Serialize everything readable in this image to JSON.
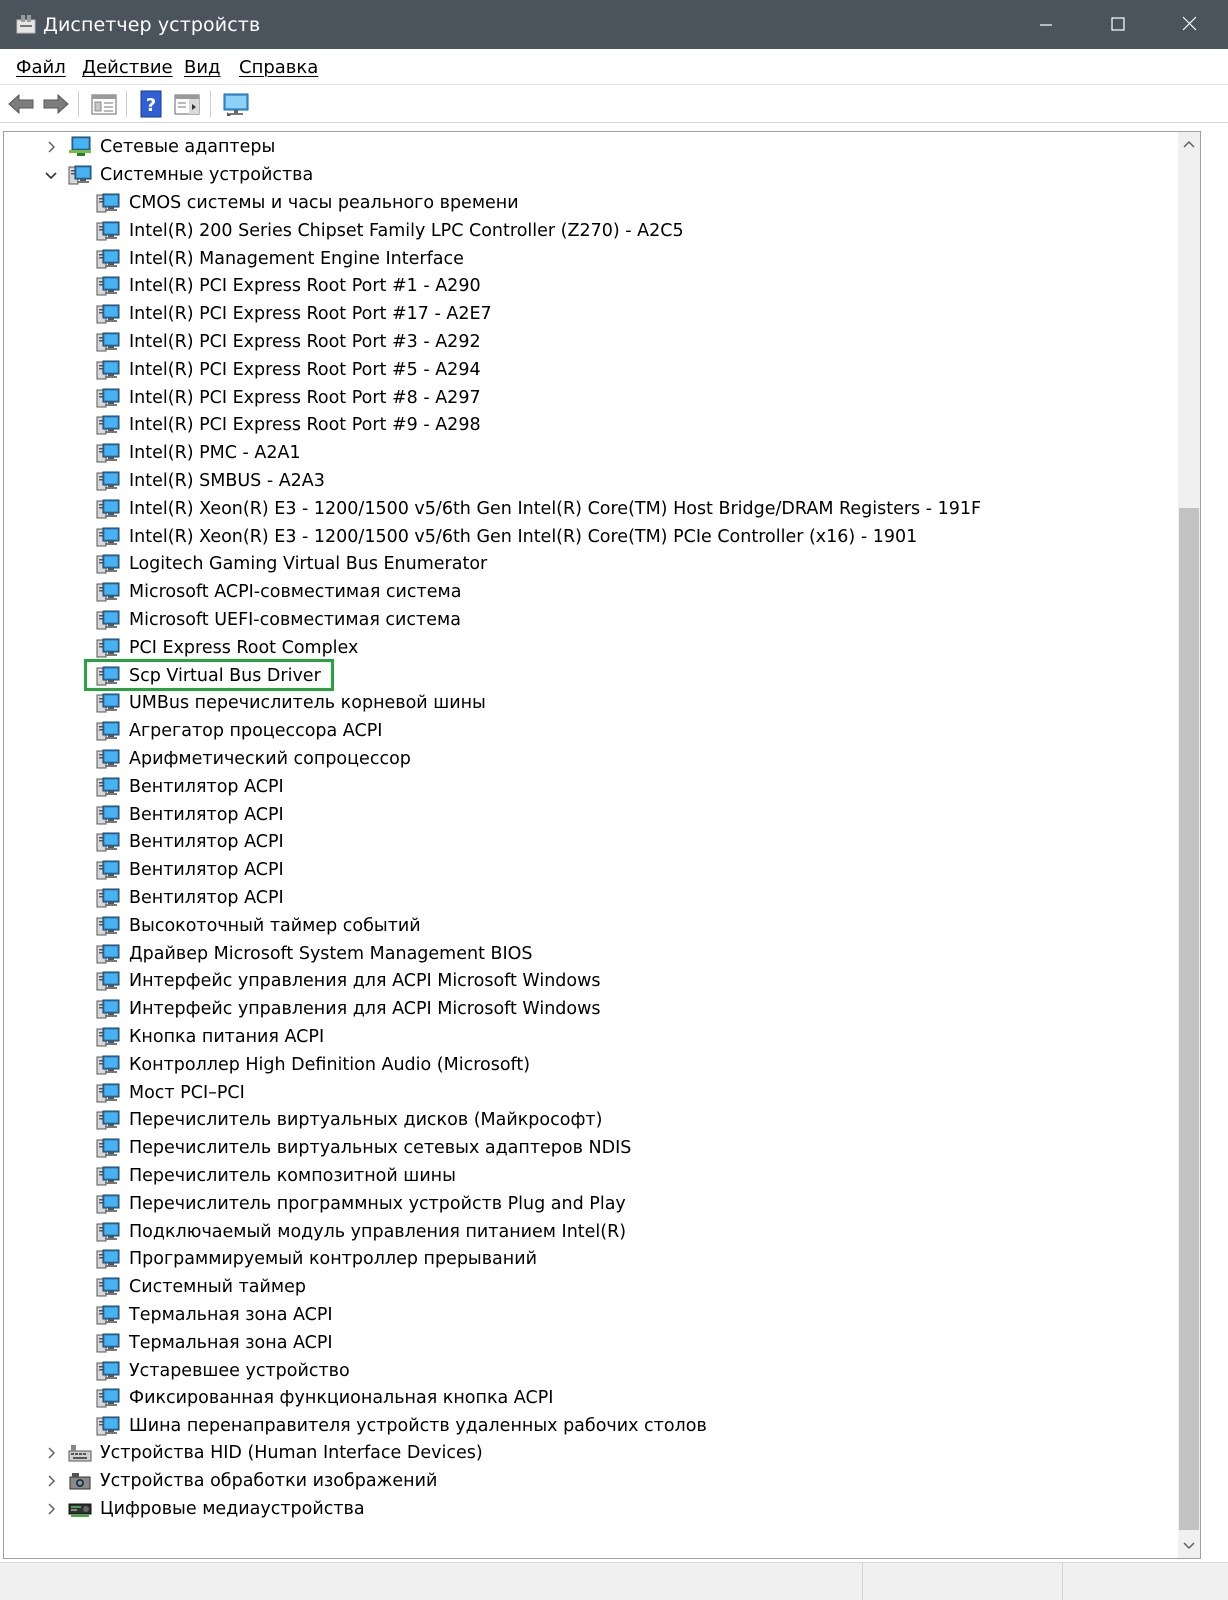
{
  "window": {
    "title": "Диспетчер устройств",
    "app_icon": "device-manager-icon",
    "controls": [
      "minimize-icon",
      "maximize-icon",
      "close-icon"
    ]
  },
  "menu": {
    "file": "Файл",
    "action": "Действие",
    "view": "Вид",
    "help": "Справка"
  },
  "toolbar": {
    "buttons": [
      "back-arrow-icon",
      "forward-arrow-icon",
      "properties-icon",
      "help-icon",
      "action-pane-icon",
      "monitor-scan-icon"
    ]
  },
  "tree": {
    "categories": {
      "network": "Сетевые адаптеры",
      "system": "Системные устройства",
      "hid": "Устройства HID (Human Interface Devices)",
      "imaging": "Устройства обработки изображений",
      "media": "Цифровые медиаустройства"
    },
    "system_devices": [
      "CMOS системы и часы реального времени",
      "Intel(R) 200 Series Chipset Family LPC Controller (Z270) - A2C5",
      "Intel(R) Management Engine Interface",
      "Intel(R) PCI Express Root Port #1 - A290",
      "Intel(R) PCI Express Root Port #17 - A2E7",
      "Intel(R) PCI Express Root Port #3 - A292",
      "Intel(R) PCI Express Root Port #5 - A294",
      "Intel(R) PCI Express Root Port #8 - A297",
      "Intel(R) PCI Express Root Port #9 - A298",
      "Intel(R) PMC - A2A1",
      "Intel(R) SMBUS - A2A3",
      "Intel(R) Xeon(R) E3 - 1200/1500 v5/6th Gen Intel(R) Core(TM) Host Bridge/DRAM Registers - 191F",
      "Intel(R) Xeon(R) E3 - 1200/1500 v5/6th Gen Intel(R) Core(TM) PCIe Controller (x16) - 1901",
      "Logitech Gaming Virtual Bus Enumerator",
      "Microsoft ACPI-совместимая система",
      "Microsoft UEFI-совместимая система",
      "PCI Express Root Complex",
      "Scp Virtual Bus Driver",
      "UMBus перечислитель корневой шины",
      "Агрегатор процессора ACPI",
      "Арифметический сопроцессор",
      "Вентилятор ACPI",
      "Вентилятор ACPI",
      "Вентилятор ACPI",
      "Вентилятор ACPI",
      "Вентилятор ACPI",
      "Высокоточный таймер событий",
      "Драйвер Microsoft System Management BIOS",
      "Интерфейс управления для ACPI Microsoft Windows",
      "Интерфейс управления для ACPI Microsoft Windows",
      "Кнопка питания ACPI",
      "Контроллер High Definition Audio (Microsoft)",
      "Мост PCI–PCI",
      "Перечислитель виртуальных дисков (Майкрософт)",
      "Перечислитель виртуальных сетевых адаптеров NDIS",
      "Перечислитель композитной шины",
      "Перечислитель программных устройств Plug and Play",
      "Подключаемый модуль управления питанием Intel(R)",
      "Программируемый контроллер прерываний",
      "Системный таймер",
      "Термальная зона ACPI",
      "Термальная зона ACPI",
      "Устаревшее устройство",
      "Фиксированная функциональная кнопка ACPI",
      "Шина перенаправителя устройств удаленных рабочих столов"
    ]
  },
  "colors": {
    "titlebar": "#4b535c",
    "highlight": "#27a53c",
    "device_icon_screen": "#2b9de8"
  }
}
